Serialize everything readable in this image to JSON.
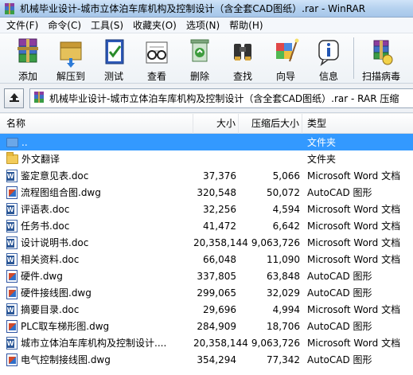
{
  "window": {
    "title": "机械毕业设计-城市立体泊车库机构及控制设计（含全套CAD图纸）.rar - WinRAR"
  },
  "menu": [
    "文件(F)",
    "命令(C)",
    "工具(S)",
    "收藏夹(O)",
    "选项(N)",
    "帮助(H)"
  ],
  "toolbar": {
    "buttons": [
      {
        "label": "添加",
        "icon": "add-archive-icon"
      },
      {
        "label": "解压到",
        "icon": "extract-icon"
      },
      {
        "label": "测试",
        "icon": "test-icon"
      },
      {
        "label": "查看",
        "icon": "view-icon"
      },
      {
        "label": "删除",
        "icon": "delete-icon"
      },
      {
        "label": "查找",
        "icon": "find-icon"
      },
      {
        "label": "向导",
        "icon": "wizard-icon"
      },
      {
        "label": "信息",
        "icon": "info-icon"
      },
      {
        "label": "扫描病毒",
        "icon": "virus-scan-icon"
      }
    ]
  },
  "address": {
    "path": "机械毕业设计-城市立体泊车库机构及控制设计（含全套CAD图纸）.rar - RAR 压缩"
  },
  "columns": {
    "name": "名称",
    "size": "大小",
    "packed": "压缩后大小",
    "type": "类型"
  },
  "files": [
    {
      "name": "..",
      "size": "",
      "packed": "",
      "type": "文件夹",
      "kind": "up",
      "selected": true
    },
    {
      "name": "外文翻译",
      "size": "",
      "packed": "",
      "type": "文件夹",
      "kind": "folder"
    },
    {
      "name": "鉴定意见表.doc",
      "size": "37,376",
      "packed": "5,066",
      "type": "Microsoft Word 文档",
      "kind": "doc"
    },
    {
      "name": "流程图组合图.dwg",
      "size": "320,548",
      "packed": "50,072",
      "type": "AutoCAD 图形",
      "kind": "dwg"
    },
    {
      "name": "评语表.doc",
      "size": "32,256",
      "packed": "4,594",
      "type": "Microsoft Word 文档",
      "kind": "doc"
    },
    {
      "name": "任务书.doc",
      "size": "41,472",
      "packed": "6,642",
      "type": "Microsoft Word 文档",
      "kind": "doc"
    },
    {
      "name": "设计说明书.doc",
      "size": "20,358,144",
      "packed": "9,063,726",
      "type": "Microsoft Word 文档",
      "kind": "doc"
    },
    {
      "name": "相关资料.doc",
      "size": "66,048",
      "packed": "11,090",
      "type": "Microsoft Word 文档",
      "kind": "doc"
    },
    {
      "name": "硬件.dwg",
      "size": "337,805",
      "packed": "63,848",
      "type": "AutoCAD 图形",
      "kind": "dwg"
    },
    {
      "name": "硬件接线图.dwg",
      "size": "299,065",
      "packed": "32,029",
      "type": "AutoCAD 图形",
      "kind": "dwg"
    },
    {
      "name": "摘要目录.doc",
      "size": "29,696",
      "packed": "4,994",
      "type": "Microsoft Word 文档",
      "kind": "doc"
    },
    {
      "name": "PLC取车梯形图.dwg",
      "size": "284,909",
      "packed": "18,706",
      "type": "AutoCAD 图形",
      "kind": "dwg"
    },
    {
      "name": "城市立体泊车库机构及控制设计....",
      "size": "20,358,144",
      "packed": "9,063,726",
      "type": "Microsoft Word 文档",
      "kind": "doc"
    },
    {
      "name": "电气控制接线图.dwg",
      "size": "354,294",
      "packed": "77,342",
      "type": "AutoCAD 图形",
      "kind": "dwg"
    }
  ]
}
